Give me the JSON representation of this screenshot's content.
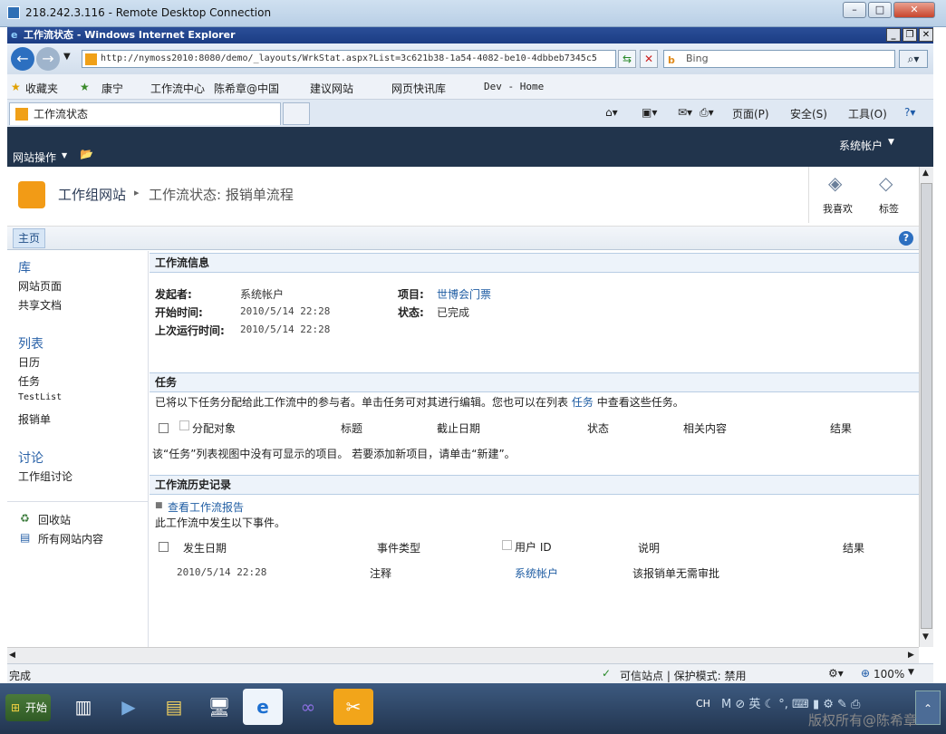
{
  "rdp": {
    "title": "218.242.3.116 - Remote Desktop Connection"
  },
  "ie": {
    "title": "工作流状态 - Windows Internet Explorer",
    "address": "http://nymoss2010:8080/demo/_layouts/WrkStat.aspx?List=3c621b38-1a54-4082-be10-4dbbeb7345c5",
    "search_placeholder": "Bing",
    "favorites_label": "收藏夹",
    "fav_items": [
      "康宁",
      "工作流中心",
      "陈希章@中国",
      "建议网站",
      "网页快讯库",
      "Dev - Home"
    ],
    "tab_title": "工作流状态",
    "cmd_page": "页面(P)",
    "cmd_safety": "安全(S)",
    "cmd_tools": "工具(O)"
  },
  "sp": {
    "site_actions": "网站操作",
    "user": "系统帐户",
    "site_title": "工作组网站",
    "separator": "▸",
    "page_title": "工作流状态: 报销单流程",
    "i_like": "我喜欢",
    "tags": "标签",
    "home_tab": "主页",
    "help": "?"
  },
  "nav": {
    "libraries": "库",
    "site_pages": "网站页面",
    "shared_docs": "共享文档",
    "lists": "列表",
    "calendar": "日历",
    "tasks": "任务",
    "testlist": "TestList",
    "expense": "报销单",
    "discussions": "讨论",
    "team_discussion": "工作组讨论",
    "recycle": "回收站",
    "all_content": "所有网站内容"
  },
  "info": {
    "header": "工作流信息",
    "initiator_label": "发起者:",
    "initiator": "系统帐户",
    "started_label": "开始时间:",
    "started": "2010/5/14 22:28",
    "lastrun_label": "上次运行时间:",
    "lastrun": "2010/5/14 22:28",
    "item_label": "项目:",
    "item": "世博会门票",
    "status_label": "状态:",
    "status": "已完成"
  },
  "tasks": {
    "header": "任务",
    "desc": "已将以下任务分配给此工作流中的参与者。单击任务可对其进行编辑。您也可以在列表",
    "desc_link": "任务",
    "desc_end": "中查看这些任务。",
    "cols": [
      "分配对象",
      "标题",
      "截止日期",
      "状态",
      "相关内容",
      "结果"
    ],
    "empty": "该“任务”列表视图中没有可显示的项目。 若要添加新项目，请单击“新建”。"
  },
  "history": {
    "header": "工作流历史记录",
    "report_link": "查看工作流报告",
    "desc": "此工作流中发生以下事件。",
    "cols": [
      "发生日期",
      "事件类型",
      "用户 ID",
      "说明",
      "结果"
    ],
    "row": {
      "date": "2010/5/14 22:28",
      "type": "注释",
      "user": "系统帐户",
      "desc": "该报销单无需审批",
      "result": ""
    }
  },
  "statusbar": {
    "done": "完成",
    "zone": "可信站点 | 保护模式: 禁用",
    "zoom": "100%"
  },
  "taskbar": {
    "start": "开始",
    "lang": "CH"
  },
  "watermark": "版权所有@陈希章"
}
